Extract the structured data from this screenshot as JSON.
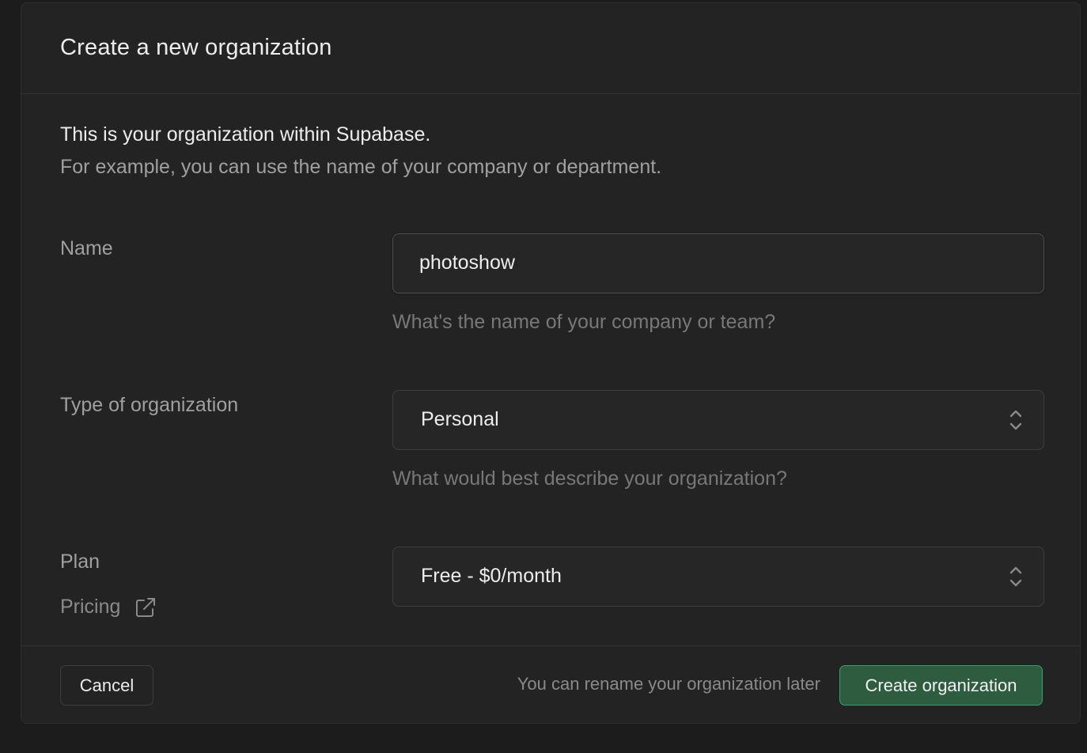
{
  "dialog": {
    "title": "Create a new organization",
    "intro_line1": "This is your organization within Supabase.",
    "intro_line2": "For example, you can use the name of your company or department."
  },
  "form": {
    "name": {
      "label": "Name",
      "value": "photoshow",
      "help": "What's the name of your company or team?"
    },
    "type": {
      "label": "Type of organization",
      "selected": "Personal",
      "help": "What would best describe your organization?"
    },
    "plan": {
      "label": "Plan",
      "pricing_link": "Pricing",
      "selected": "Free - $0/month"
    }
  },
  "footer": {
    "cancel_label": "Cancel",
    "note": "You can rename your organization later",
    "create_label": "Create organization"
  },
  "icons": {
    "select": "chevron-up-down-icon",
    "pricing": "external-link-icon"
  },
  "colors": {
    "background": "#1c1c1c",
    "panel": "#232323",
    "primary_button": "#2d5c3f",
    "primary_border": "#34a06c"
  }
}
